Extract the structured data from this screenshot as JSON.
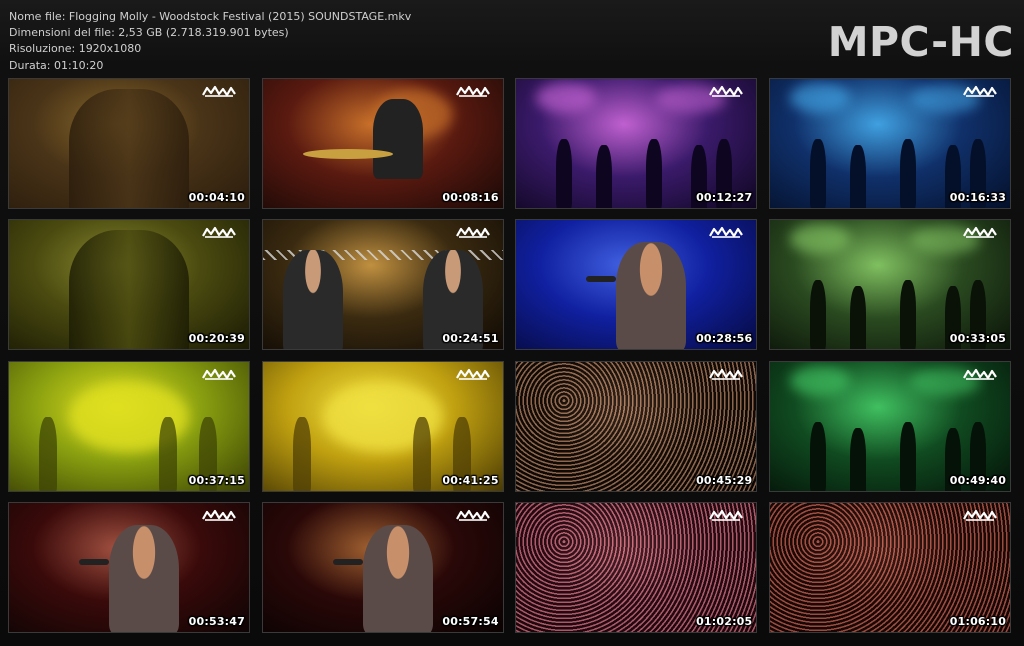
{
  "file_info": {
    "name_line": "Nome file: Flogging Molly - Woodstock Festival (2015) SOUNDSTAGE.mkv",
    "size_line": "Dimensioni del file: 2,53 GB (2.718.319.901 bytes)",
    "resolution_line": "Risoluzione: 1920x1080",
    "duration_line": "Durata: 01:10:20"
  },
  "logo": "MPC-HC",
  "thumbnails": [
    {
      "timestamp": "00:04:10",
      "palette": [
        "#4a3418",
        "#8a6a2a",
        "#2a1c0c"
      ],
      "scene": "closeup"
    },
    {
      "timestamp": "00:08:16",
      "palette": [
        "#5a1a10",
        "#c8702a",
        "#1a0806"
      ],
      "scene": "drummer"
    },
    {
      "timestamp": "00:12:27",
      "palette": [
        "#3a1a6a",
        "#c060d0",
        "#0e0620"
      ],
      "scene": "stage"
    },
    {
      "timestamp": "00:16:33",
      "palette": [
        "#10306a",
        "#40a0e0",
        "#04102a"
      ],
      "scene": "stage"
    },
    {
      "timestamp": "00:20:39",
      "palette": [
        "#4a4a10",
        "#8a8a30",
        "#1a1a04"
      ],
      "scene": "closeup"
    },
    {
      "timestamp": "00:24:51",
      "palette": [
        "#3a2a10",
        "#c09040",
        "#100a04"
      ],
      "scene": "truss"
    },
    {
      "timestamp": "00:28:56",
      "palette": [
        "#1020a0",
        "#4060e0",
        "#060a40"
      ],
      "scene": "singer"
    },
    {
      "timestamp": "00:33:05",
      "palette": [
        "#2a4a20",
        "#80c060",
        "#0a1208"
      ],
      "scene": "stage"
    },
    {
      "timestamp": "00:37:15",
      "palette": [
        "#8aa010",
        "#e0e020",
        "#3a4004"
      ],
      "scene": "haze"
    },
    {
      "timestamp": "00:41:25",
      "palette": [
        "#c0a010",
        "#f0e040",
        "#4a3a04"
      ],
      "scene": "haze"
    },
    {
      "timestamp": "00:45:29",
      "palette": [
        "#2a1a10",
        "#b08060",
        "#0a0604"
      ],
      "scene": "crowd"
    },
    {
      "timestamp": "00:49:40",
      "palette": [
        "#104a20",
        "#40c060",
        "#041208"
      ],
      "scene": "stage"
    },
    {
      "timestamp": "00:53:47",
      "palette": [
        "#3a0a0a",
        "#a05040",
        "#0e0404"
      ],
      "scene": "singer"
    },
    {
      "timestamp": "00:57:54",
      "palette": [
        "#2a0808",
        "#a06030",
        "#0a0202"
      ],
      "scene": "singer"
    },
    {
      "timestamp": "01:02:05",
      "palette": [
        "#4a1a2a",
        "#d07080",
        "#1a060a"
      ],
      "scene": "crowd"
    },
    {
      "timestamp": "01:06:10",
      "palette": [
        "#3a1410",
        "#c06050",
        "#120604"
      ],
      "scene": "crowd"
    }
  ]
}
